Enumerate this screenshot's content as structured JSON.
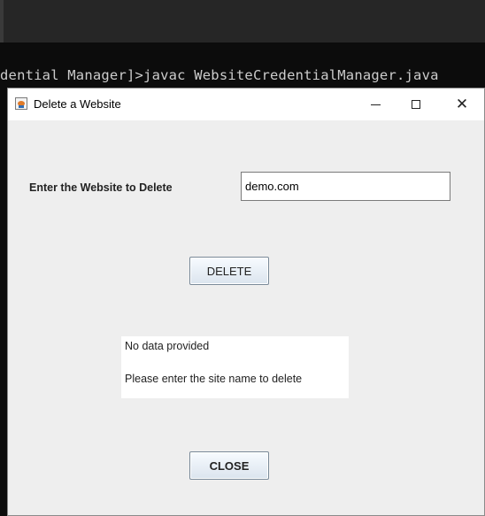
{
  "background_terminal": {
    "command_line": "dential Manager]>javac WebsiteCredentialManager.java"
  },
  "dialog": {
    "title": "Delete a Website",
    "window_controls": {
      "minimize_icon": "minimize-icon",
      "maximize_icon": "maximize-icon",
      "close_symbol": "✕"
    },
    "field_label": "Enter the Website to Delete",
    "site_input": {
      "value": "demo.com",
      "placeholder": ""
    },
    "delete_button_label": "DELETE",
    "message": {
      "line1": "No  data  provided",
      "line2": "Please enter the site name to delete"
    },
    "close_button_label": "CLOSE"
  },
  "colors": {
    "dialog_bg": "#eeeeee",
    "terminal_bg": "#0c0c0c",
    "button_gradient_top": "#f7fbff",
    "button_gradient_bottom": "#dbe4ee"
  }
}
